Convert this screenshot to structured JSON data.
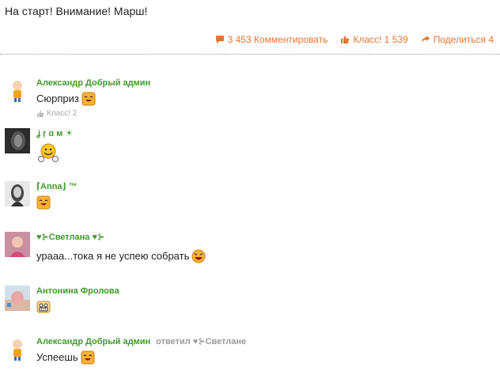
{
  "post": {
    "title": "На старт! Внимание! Марш!"
  },
  "actions": {
    "comments": "3 453 Комментировать",
    "klass": "Класс! 1 539",
    "share": "Поделиться 4"
  },
  "comments": [
    {
      "author": "Александр Добрый админ",
      "text": "Сюрприз",
      "klass": "Класс! 2"
    },
    {
      "author": "ʝ ŗ ɑ м ☀",
      "text": ""
    },
    {
      "author": "⌈Anna⌋ ™",
      "text": ""
    },
    {
      "author": "♥⊱Светлана ♥⊱",
      "text": "урааа...тока я не успею собрать"
    },
    {
      "author": "Антонина Фролова",
      "text": ""
    },
    {
      "author": "Александр Добрый админ",
      "reply": "ответил ♥⊱Светлане",
      "text": "Успеешь"
    }
  ],
  "colors": {
    "accent": "#eb722e",
    "author": "#3f9b2c",
    "muted": "#999999"
  }
}
